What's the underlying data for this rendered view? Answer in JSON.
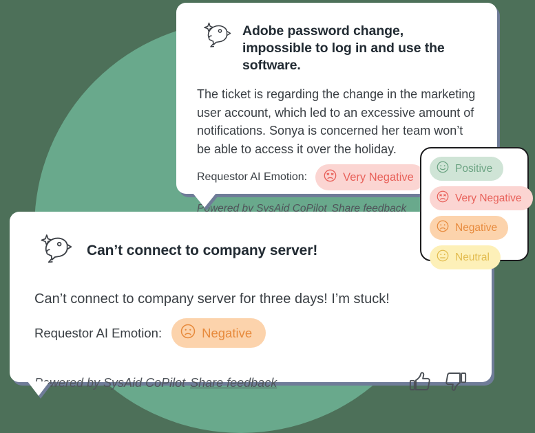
{
  "theme": {
    "background_dark_green": "#4d7059",
    "background_circle_green": "#69a98c",
    "card_shadow_slate": "#6f7c98",
    "card_white": "#ffffff",
    "text_dark": "#222b33",
    "text_body": "#3a3f44",
    "very_negative_bg": "#fbd5d2",
    "very_negative_fg": "#e8615a",
    "negative_bg": "#fcd3ac",
    "negative_fg": "#e78a3c",
    "positive_bg": "#cfe4d6",
    "positive_fg": "#6ba382",
    "neutral_bg": "#fdf0b8",
    "neutral_fg": "#e2bb4e",
    "dropdown_border": "#1b1b1d"
  },
  "top_card": {
    "icon": "copilot-bird-icon",
    "title": "Adobe password change, impossible to log in and use the software.",
    "summary": "The ticket is regarding the change in the marketing user account, which led to an excessive amount of notifications. Sonya is concerned her team won’t be able to access it over the holiday.",
    "emotion_label": "Requestor AI Emotion:",
    "emotion_value": "Very Negative",
    "emotion_face": "very-negative-face-icon",
    "footer_powered_by": "Powered by SysAid CoPilot",
    "footer_share": "Share feedback"
  },
  "bottom_card": {
    "icon": "copilot-bird-icon",
    "title": "Can’t connect to company server!",
    "summary": "Can’t connect to company server for three days! I’m stuck!",
    "emotion_label": "Requestor AI Emotion:",
    "emotion_value": "Negative",
    "emotion_face": "negative-face-icon",
    "footer_powered_by": "Powered by SysAid CoPilot",
    "footer_share": "Share feedback",
    "thumbs_up": "thumbs-up-icon",
    "thumbs_down": "thumbs-down-icon"
  },
  "emotion_dropdown": {
    "options": [
      {
        "label": "Positive",
        "face": "positive-face-icon",
        "variant": "positive"
      },
      {
        "label": "Very Negative",
        "face": "very-negative-face-icon",
        "variant": "verynegative"
      },
      {
        "label": "Negative",
        "face": "negative-face-icon",
        "variant": "negative"
      },
      {
        "label": "Neutral",
        "face": "neutral-face-icon",
        "variant": "neutral"
      }
    ]
  }
}
